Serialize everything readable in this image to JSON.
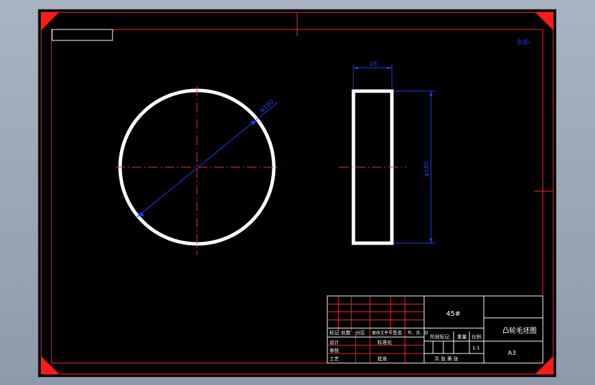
{
  "drawing": {
    "stamp": "全部√",
    "circle_dimension": "φ180",
    "side_width_dimension": "18",
    "side_height_dimension": "φ180"
  },
  "title_block": {
    "material": "45#",
    "part_name": "凸轮毛坯图",
    "scale": "1:1",
    "sheet_size": "A3",
    "row_labels": [
      "标记",
      "处数",
      "分区",
      "更改文件号",
      "签名",
      "年、月、日"
    ],
    "design_label": "设计",
    "std_label": "标准化",
    "review_label": "审核",
    "process_label": "工艺",
    "approve_label": "批准",
    "stage_label": "阶段标记",
    "weight_label": "重量",
    "ratio_label": "比例",
    "sheets_label": "共   张  第   张"
  },
  "colors": {
    "background": "#000000",
    "frame": "#ff2a2a",
    "geometry": "#ffffff",
    "dimension": "#1f3fff",
    "corner": "#ff1a1a"
  }
}
